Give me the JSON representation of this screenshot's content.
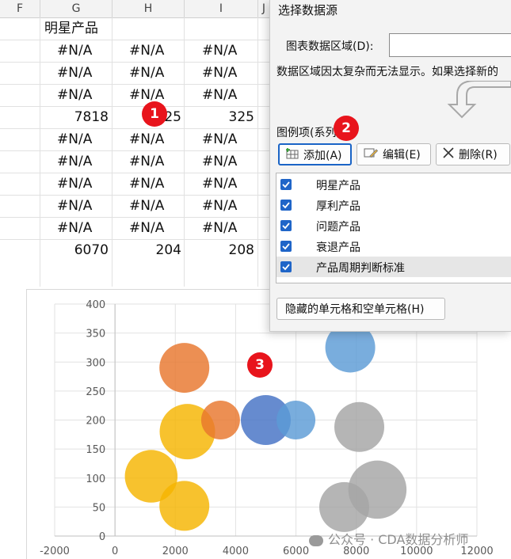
{
  "sheet": {
    "columns": [
      "F",
      "G",
      "H",
      "I",
      "J"
    ],
    "header_cell": "明星产品",
    "rows": [
      [
        "#N/A",
        "#N/A",
        "#N/A"
      ],
      [
        "#N/A",
        "#N/A",
        "#N/A"
      ],
      [
        "#N/A",
        "#N/A",
        "#N/A"
      ],
      [
        "7818",
        "25",
        "325"
      ],
      [
        "#N/A",
        "#N/A",
        "#N/A"
      ],
      [
        "#N/A",
        "#N/A",
        "#N/A"
      ],
      [
        "#N/A",
        "#N/A",
        "#N/A"
      ],
      [
        "#N/A",
        "#N/A",
        "#N/A"
      ],
      [
        "#N/A",
        "#N/A",
        "#N/A"
      ],
      [
        "6070",
        "204",
        "208"
      ]
    ]
  },
  "dialog": {
    "title": "选择数据源",
    "range_label": "图表数据区域(D):",
    "range_value": "",
    "info_text": "数据区域因太复杂而无法显示。如果选择新的",
    "legend_label": "图例项(系列)",
    "add_label": "添加(A)",
    "edit_label": "编辑(E)",
    "delete_label": "删除(R)",
    "series": [
      {
        "name": "明星产品",
        "checked": true
      },
      {
        "name": "厚利产品",
        "checked": true
      },
      {
        "name": "问题产品",
        "checked": true
      },
      {
        "name": "衰退产品",
        "checked": true
      },
      {
        "name": "产品周期判断标准",
        "checked": true
      }
    ],
    "hidden_cells_label": "隐藏的单元格和空单元格(H)"
  },
  "badges": [
    "1",
    "2",
    "3"
  ],
  "watermark": "公众号 · CDA数据分析师",
  "chart_data": {
    "type": "scatter",
    "subtype": "bubble",
    "xlim": [
      -2000,
      12000
    ],
    "ylim": [
      0,
      400
    ],
    "x_ticks": [
      "-2000",
      "0",
      "2000",
      "4000",
      "6000",
      "8000",
      "10000",
      "12000"
    ],
    "y_ticks": [
      "0",
      "50",
      "100",
      "150",
      "200",
      "250",
      "300",
      "350",
      "400"
    ],
    "grid": true,
    "series": [
      {
        "color": "#f5b400",
        "points": [
          [
            2400,
            180,
            20
          ],
          [
            1200,
            103,
            19
          ],
          [
            2300,
            52,
            18
          ]
        ]
      },
      {
        "color": "#e8762d",
        "points": [
          [
            2300,
            290,
            18
          ],
          [
            3500,
            200,
            14
          ]
        ]
      },
      {
        "color": "#4472c4",
        "points": [
          [
            5000,
            200,
            18
          ]
        ]
      },
      {
        "color": "#5b9bd5",
        "points": [
          [
            7800,
            325,
            18
          ],
          [
            6000,
            200,
            14
          ]
        ]
      },
      {
        "color": "#a5a5a5",
        "points": [
          [
            8100,
            188,
            18
          ],
          [
            8700,
            80,
            21
          ],
          [
            7600,
            50,
            18
          ]
        ]
      }
    ]
  }
}
